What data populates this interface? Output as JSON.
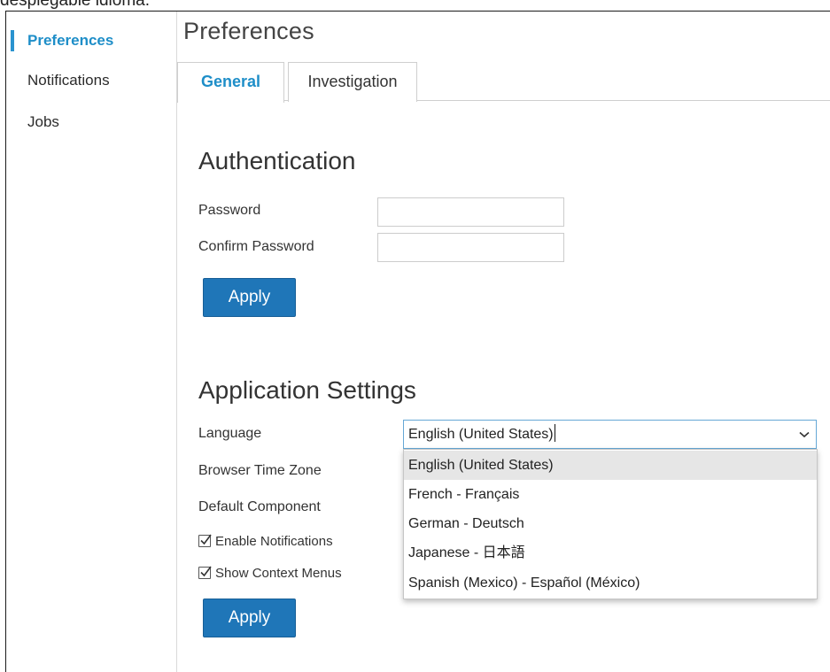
{
  "caption": "desplegable idioma.",
  "sidebar": {
    "items": [
      {
        "label": "Preferences",
        "active": true
      },
      {
        "label": "Notifications",
        "active": false
      },
      {
        "label": "Jobs",
        "active": false
      }
    ]
  },
  "page": {
    "title": "Preferences"
  },
  "tabs": [
    {
      "label": "General",
      "active": true
    },
    {
      "label": "Investigation",
      "active": false
    }
  ],
  "authentication": {
    "title": "Authentication",
    "password_label": "Password",
    "password_value": "",
    "confirm_label": "Confirm Password",
    "confirm_value": "",
    "apply_label": "Apply"
  },
  "app_settings": {
    "title": "Application Settings",
    "language_label": "Language",
    "language_value": "English (United States)",
    "timezone_label": "Browser Time Zone",
    "component_label": "Default Component",
    "enable_notifications_label": "Enable Notifications",
    "enable_notifications_checked": true,
    "show_context_menus_label": "Show Context Menus",
    "show_context_menus_checked": true,
    "apply_label": "Apply",
    "language_options": [
      {
        "label": "English (United States)",
        "selected": true
      },
      {
        "label": "French - Français",
        "selected": false
      },
      {
        "label": "German - Deutsch",
        "selected": false
      },
      {
        "label": "Japanese - 日本語",
        "selected": false
      },
      {
        "label": "Spanish (Mexico) - Español (México)",
        "selected": false
      }
    ]
  },
  "colors": {
    "accent": "#1e8ec8",
    "button": "#1f76b8",
    "selected_option_bg": "#e6e6e6"
  },
  "icons": {
    "select_arrow": "chevron-down-icon",
    "checkbox": "checkmark-icon"
  }
}
